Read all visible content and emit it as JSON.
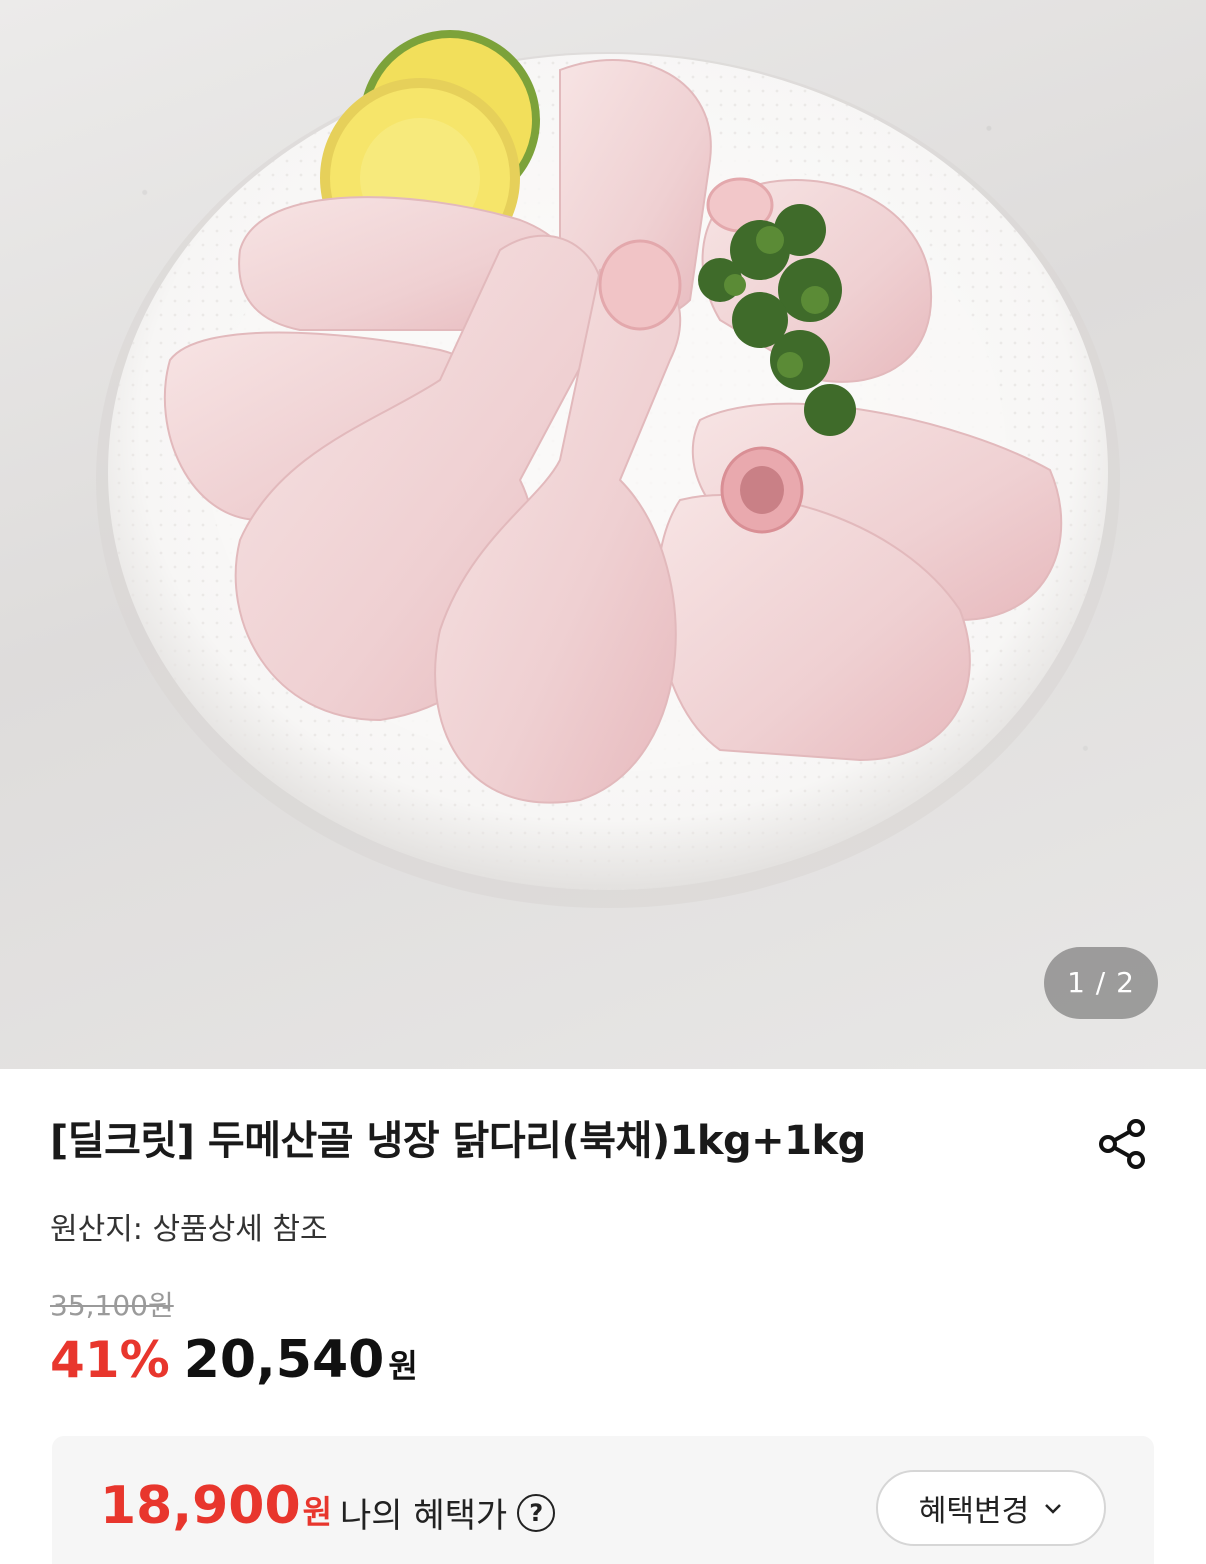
{
  "gallery": {
    "image_description_icon": "chicken-drumsticks-photo",
    "pager_current": "1",
    "pager_total": "2",
    "pager_text": "1 / 2"
  },
  "product": {
    "title": "[딜크릿] 두메산골 냉장 닭다리(북채)1kg+1kg",
    "origin": "원산지: 상품상세 참조",
    "original_price": "35,100원",
    "discount_rate": "41%",
    "sale_price": "20,540",
    "currency": "원"
  },
  "benefit": {
    "price": "18,900",
    "currency": "원",
    "label": "나의 혜택가",
    "help_symbol": "?",
    "change_button_label": "혜택변경"
  },
  "colors": {
    "discount_red": "#e8362d",
    "text_dark": "#111111",
    "muted_gray": "#9a9a9a",
    "benefit_bg": "#f6f6f6"
  },
  "icons": {
    "share": "share-icon",
    "help": "question-circle-icon",
    "chevron": "chevron-down-icon"
  }
}
